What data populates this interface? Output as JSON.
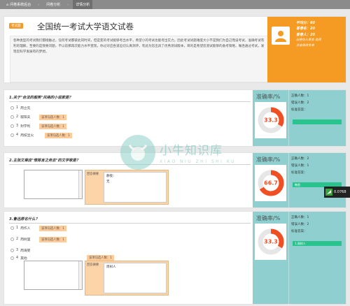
{
  "nav": {
    "items": [
      {
        "label": "问卷系统后台"
      },
      {
        "label": "问卷分析"
      },
      {
        "label": "详情分析"
      }
    ]
  },
  "header": {
    "badge": "考试题",
    "title": "全国统一考试大学语文试卷",
    "description": "各种类型的考试我们都接触过，任何考试都彼此同时间，但是变的考试能够考出水平，希望小的考试也能考出实力。因此考试试题难度大小不是我们为自己而设考试，准确考试有利的理解，至要的是我要问题，不以前那再次能力水平变现，你过对应各道迫切认真测评，有此为您出具了优秀测试版本，目的是希望您测试能够的备考策略，做连通过考试，发现您科学发展有的梦想。"
  },
  "profile": {
    "score_label": "平均分：60",
    "rank_label": "答卷名：20",
    "count_label": "答卷人：20",
    "line4": "出卷份人某会 选择",
    "line5": "点击修改名单"
  },
  "watermark": {
    "title": "小牛知识库",
    "subtitle": "XIAO NIU ZHI SHI KU"
  },
  "side_widget": {
    "value": "0.0768"
  },
  "questions": [
    {
      "text": "1.关于\"合法的般笑\"风格的小说家是？",
      "options": [
        {
          "num": "1",
          "label": "周立先"
        },
        {
          "num": "2",
          "label": "郁阳夫"
        },
        {
          "num": "3",
          "label": "封学利"
        },
        {
          "num": "4",
          "label": "周枝显火"
        }
      ],
      "tags": [
        "该项勾选人数：1",
        "该项勾选人数：1",
        "该项勾选人数：1"
      ],
      "accuracy_title": "准确率/%",
      "accuracy_value": "33.3",
      "accuracy_fraction": 0.333,
      "stats": {
        "correct": "正确人数：1",
        "wrong": "错误人数：2",
        "answer_label": "标准答案："
      }
    },
    {
      "text": "2.主张文章应\"惟陈言之务去\"的文学家是？",
      "comment_label": "回答摘要",
      "comment_lines": [
        "静夜：",
        "无"
      ],
      "accuracy_title": "准确率/%",
      "accuracy_value": "66.7",
      "accuracy_fraction": 0.667,
      "stats": {
        "correct": "正确人数：2",
        "wrong": "错误人数：1",
        "answer_label": "标准答案："
      },
      "answer": "韩愈"
    },
    {
      "text": "3.鲁迅原名什么？",
      "options": [
        {
          "num": "1",
          "label": "周作人"
        },
        {
          "num": "2",
          "label": "周树里"
        },
        {
          "num": "3",
          "label": "周海婴"
        },
        {
          "num": "4",
          "label": "其他"
        }
      ],
      "tags": [
        "该项勾选人数：1",
        "该项勾选人数：1",
        "该项勾选人数：1"
      ],
      "comment_label": "回答摘要",
      "comment_lines": [
        "周树人"
      ],
      "accuracy_title": "准确率/%",
      "accuracy_value": "33.3",
      "accuracy_fraction": 0.333,
      "stats": {
        "correct": "正确人数：1",
        "wrong": "错误人数：2",
        "answer_label": "标准答案："
      },
      "answer": "1.周树人"
    }
  ],
  "colors": {
    "accent": "#f59a23",
    "teal": "#8fcfcf",
    "red": "#f04e23",
    "green": "#29c48e",
    "tag": "#ffcc99"
  }
}
